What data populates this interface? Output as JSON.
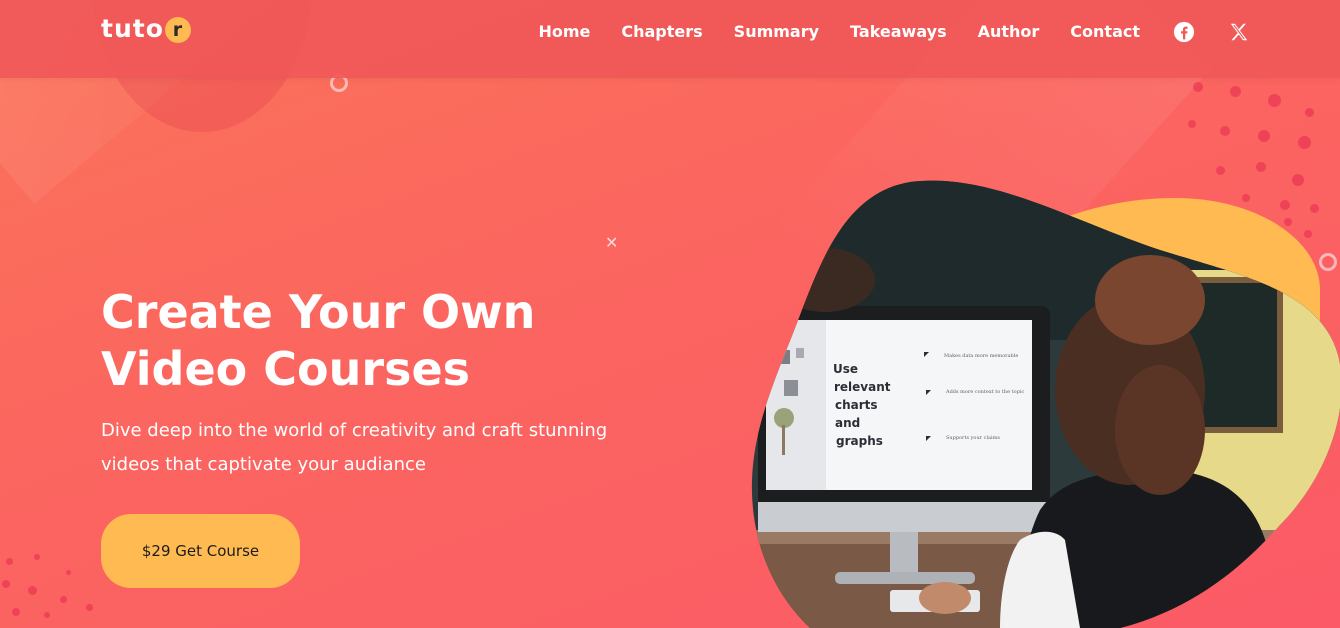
{
  "brand": {
    "logo_text": "tuto",
    "logo_badge": "r",
    "accent_color": "#ffba52",
    "primary_color": "#fb6560"
  },
  "nav": {
    "items": [
      {
        "label": "Home"
      },
      {
        "label": "Chapters"
      },
      {
        "label": "Summary"
      },
      {
        "label": "Takeaways"
      },
      {
        "label": "Author"
      },
      {
        "label": "Contact"
      }
    ],
    "social": [
      {
        "icon": "facebook-icon"
      },
      {
        "icon": "x-twitter-icon"
      }
    ]
  },
  "hero": {
    "title_line1": "Create Your Own",
    "title_line2": "Video Courses",
    "subtitle_line1": "Dive deep into the world of creativity and craft stunning",
    "subtitle_line2": "videos that captivate your audiance",
    "cta_label": "$29 Get Course"
  },
  "hero_image": {
    "monitor_slide": {
      "heading_lines": [
        "Use",
        "relevant",
        "charts",
        "and",
        "graphs"
      ],
      "bullets": [
        "Makes data more memorable",
        "Adds more context to the topic",
        "Supports your claims"
      ]
    }
  }
}
